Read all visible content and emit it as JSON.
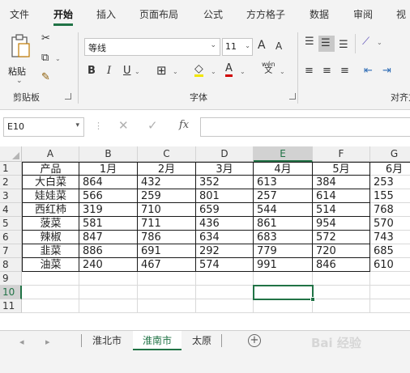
{
  "ribbon_tabs": [
    "文件",
    "开始",
    "插入",
    "页面布局",
    "公式",
    "方方格子",
    "数据",
    "审阅",
    "视"
  ],
  "active_tab": "开始",
  "clipboard": {
    "paste_label": "粘贴",
    "group_label": "剪贴板"
  },
  "font": {
    "name": "等线",
    "size": "11",
    "group_label": "字体",
    "bold": "B",
    "italic": "I",
    "underline": "U",
    "grow": "A",
    "shrink": "A",
    "wen": "wén",
    "wen_char": "文"
  },
  "alignment": {
    "group_label": "对齐方式"
  },
  "formula_bar": {
    "name_box": "E10",
    "fx": "fx",
    "value": ""
  },
  "accent_color": "#217346",
  "columns": [
    "A",
    "B",
    "C",
    "D",
    "E",
    "F",
    "G"
  ],
  "selected_column": "E",
  "row_numbers": [
    "1",
    "2",
    "3",
    "4",
    "5",
    "6",
    "7",
    "8",
    "9",
    "10",
    "11"
  ],
  "selected_row": "10",
  "table": {
    "header": [
      "产品",
      "1月",
      "2月",
      "3月",
      "4月",
      "5月",
      "6月"
    ],
    "rows": [
      [
        "大白菜",
        "864",
        "432",
        "352",
        "613",
        "384",
        "253"
      ],
      [
        "娃娃菜",
        "566",
        "259",
        "801",
        "257",
        "614",
        "155"
      ],
      [
        "西红柿",
        "319",
        "710",
        "659",
        "544",
        "514",
        "768"
      ],
      [
        "菠菜",
        "581",
        "711",
        "436",
        "861",
        "954",
        "570"
      ],
      [
        "辣椒",
        "847",
        "786",
        "634",
        "683",
        "572",
        "743"
      ],
      [
        "韭菜",
        "886",
        "691",
        "292",
        "779",
        "720",
        "685"
      ],
      [
        "油菜",
        "240",
        "467",
        "574",
        "991",
        "846",
        "610"
      ]
    ]
  },
  "sheets": [
    "淮北市",
    "淮南市",
    "太原"
  ],
  "active_sheet": "淮南市",
  "watermark": "Bai 经验"
}
